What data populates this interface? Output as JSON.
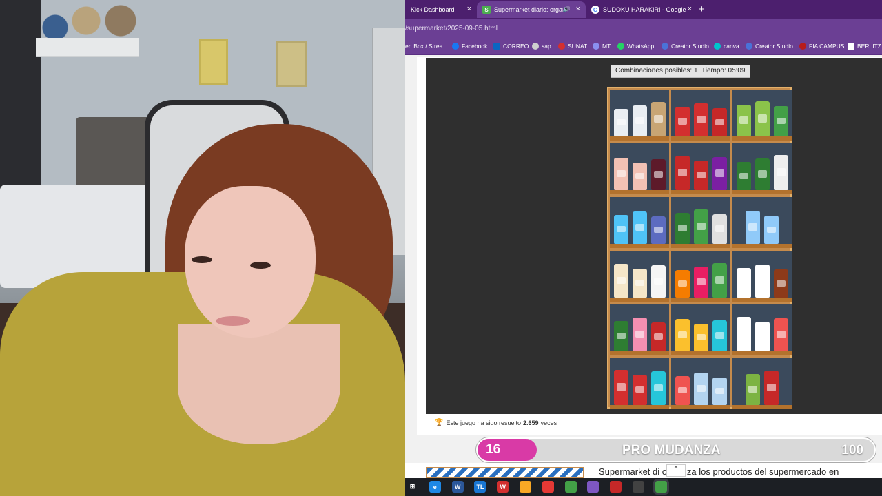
{
  "browser": {
    "tabs": [
      {
        "label": "Kick Dashboard",
        "favicon": "kick-icon",
        "color": "#53fc18"
      },
      {
        "label": "Supermarket diario: organiz",
        "favicon": "supermarket-icon",
        "color": "#4caf50",
        "active": true,
        "audio": "🔊"
      },
      {
        "label": "SUDOKU HARAKIRI - Google Sh",
        "favicon": "google-icon",
        "color": "#ffffff"
      }
    ],
    "close_glyph": "×",
    "new_tab_glyph": "+",
    "url": "/supermarket/2025-09-05.html",
    "bookmarks": [
      {
        "label": "ert Box / Strea...",
        "color": "#aaaaaa"
      },
      {
        "label": "Facebook",
        "color": "#1877f2"
      },
      {
        "label": "CORREO",
        "color": "#0a66c2"
      },
      {
        "label": "sap",
        "color": "#cfcfcf"
      },
      {
        "label": "SUNAT",
        "color": "#d32f2f"
      },
      {
        "label": "MT",
        "color": "#8a8ff0"
      },
      {
        "label": "WhatsApp",
        "color": "#25d366"
      },
      {
        "label": "Creator Studio",
        "color": "#4a72d8"
      },
      {
        "label": "canva",
        "color": "#00c4cc"
      },
      {
        "label": "Creator Studio",
        "color": "#4a72d8"
      },
      {
        "label": "FIA CAMPUS",
        "color": "#b71c1c"
      },
      {
        "label": "BERLITZ",
        "color": "#ffffff"
      }
    ]
  },
  "game": {
    "combinations_label": "Combinaciones posibles: 1",
    "timer_label": "Tiempo: 05:09",
    "shelf": [
      [
        [
          "#e9eef3",
          "#e9eef3",
          "#c8a574"
        ],
        [
          "#d32f2f",
          "#d32f2f",
          "#c62828"
        ],
        [
          "#8bc34a",
          "#8bc34a",
          "#43a047"
        ]
      ],
      [
        [
          "#f2c1b4",
          "#f2c1b4",
          "#5d1a2a"
        ],
        [
          "#c62828",
          "#c62828",
          "#7b1fa2"
        ],
        [
          "#2e7d32",
          "#2e7d32",
          "#eeeeee"
        ]
      ],
      [
        [
          "#4fc3f7",
          "#4fc3f7",
          "#5c6bc0"
        ],
        [
          "#2e7d32",
          "#43a047",
          "#e0e0e0"
        ],
        [
          "#90caf9",
          "#90caf9"
        ]
      ],
      [
        [
          "#f5e6c8",
          "#f5e6c8",
          "#f5f5f5"
        ],
        [
          "#f57c00",
          "#e91e63",
          "#43a047"
        ],
        [
          "#ffffff",
          "#ffffff",
          "#8d3a1a"
        ]
      ],
      [
        [
          "#2e7d32",
          "#f48fb1",
          "#c62828"
        ],
        [
          "#fbc02d",
          "#fbc02d",
          "#26c6da"
        ],
        [
          "#ffffff",
          "#ffffff",
          "#ef5350"
        ]
      ],
      [
        [
          "#d32f2f",
          "#d32f2f",
          "#26c6da"
        ],
        [
          "#ef5350",
          "#b3d4f0",
          "#b3d4f0"
        ],
        [
          "#7cb342",
          "#c62828"
        ]
      ]
    ],
    "solved_prefix": "Este juego ha sido resuelto",
    "solved_count": "2.659",
    "solved_suffix": "veces"
  },
  "overlay": {
    "count": "16",
    "title": "PRO MUDANZA",
    "goal": "100"
  },
  "next_article": {
    "title": "Supermarket di   organiza los productos del supermercado en"
  },
  "scroll_top_glyph": "⌃",
  "taskbar": {
    "icons": [
      {
        "name": "task-view-icon",
        "label": "⊞",
        "color": "#1c1f24"
      },
      {
        "name": "edge-icon",
        "label": "e",
        "color": "#1e88e5"
      },
      {
        "name": "word-icon",
        "label": "W",
        "color": "#2b579a"
      },
      {
        "name": "tl-icon",
        "label": "TL",
        "color": "#1976d2"
      },
      {
        "name": "wps-icon",
        "label": "W",
        "color": "#d32f2f"
      },
      {
        "name": "file-explorer-icon",
        "label": "",
        "color": "#f9a825"
      },
      {
        "name": "anydesk-icon",
        "label": "",
        "color": "#e53935"
      },
      {
        "name": "chrome-icon",
        "label": "",
        "color": "#43a047"
      },
      {
        "name": "app-icon",
        "label": "",
        "color": "#7e57c2"
      },
      {
        "name": "video-icon",
        "label": "",
        "color": "#c62828"
      },
      {
        "name": "clock-icon",
        "label": "",
        "color": "#424242"
      },
      {
        "name": "chrome-active-icon",
        "label": "",
        "color": "#43a047"
      }
    ]
  }
}
